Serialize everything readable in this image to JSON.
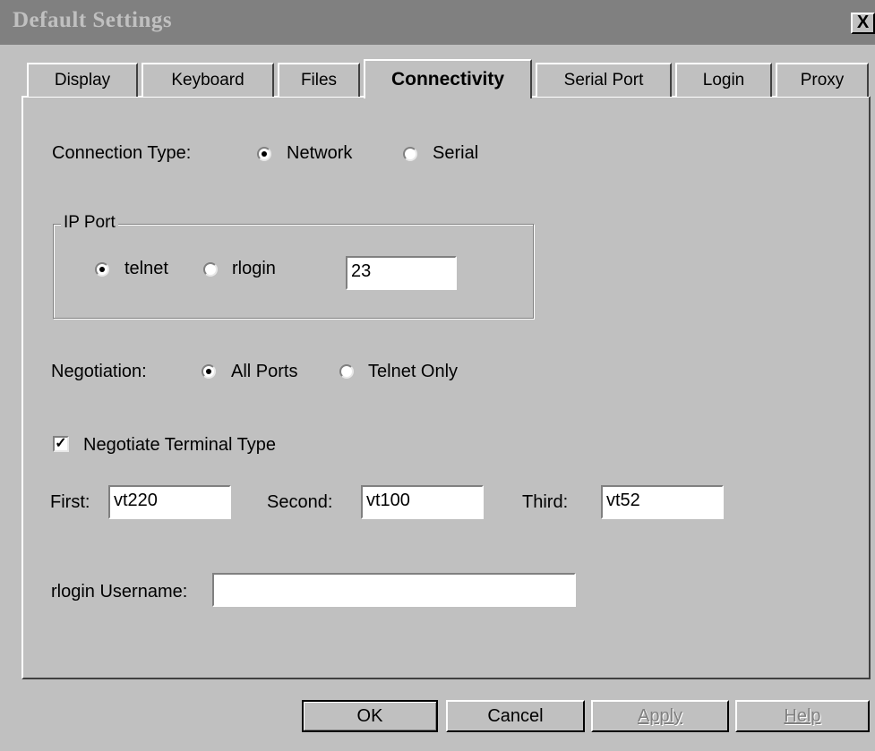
{
  "window": {
    "title": "Default Settings",
    "close_glyph": "X"
  },
  "tabs": [
    {
      "label": "Display"
    },
    {
      "label": "Keyboard"
    },
    {
      "label": "Files"
    },
    {
      "label": "Connectivity",
      "active": true
    },
    {
      "label": "Serial Port"
    },
    {
      "label": "Login"
    },
    {
      "label": "Proxy"
    }
  ],
  "connection_type": {
    "label": "Connection Type:",
    "options": [
      "Network",
      "Serial"
    ],
    "selected": "Network"
  },
  "ip_port": {
    "group_label": "IP Port",
    "options": [
      "telnet",
      "rlogin"
    ],
    "selected": "telnet",
    "port_value": "23"
  },
  "negotiation": {
    "label": "Negotiation:",
    "options": [
      "All Ports",
      "Telnet Only"
    ],
    "selected": "All Ports"
  },
  "negotiate_terminal": {
    "label": "Negotiate Terminal Type",
    "checked": true
  },
  "terminals": {
    "first_label": "First:",
    "first_value": "vt220",
    "second_label": "Second:",
    "second_value": "vt100",
    "third_label": "Third:",
    "third_value": "vt52"
  },
  "rlogin_user": {
    "label": "rlogin Username:",
    "value": ""
  },
  "buttons": {
    "ok": "OK",
    "cancel": "Cancel",
    "apply": "Apply",
    "help": "Help"
  }
}
